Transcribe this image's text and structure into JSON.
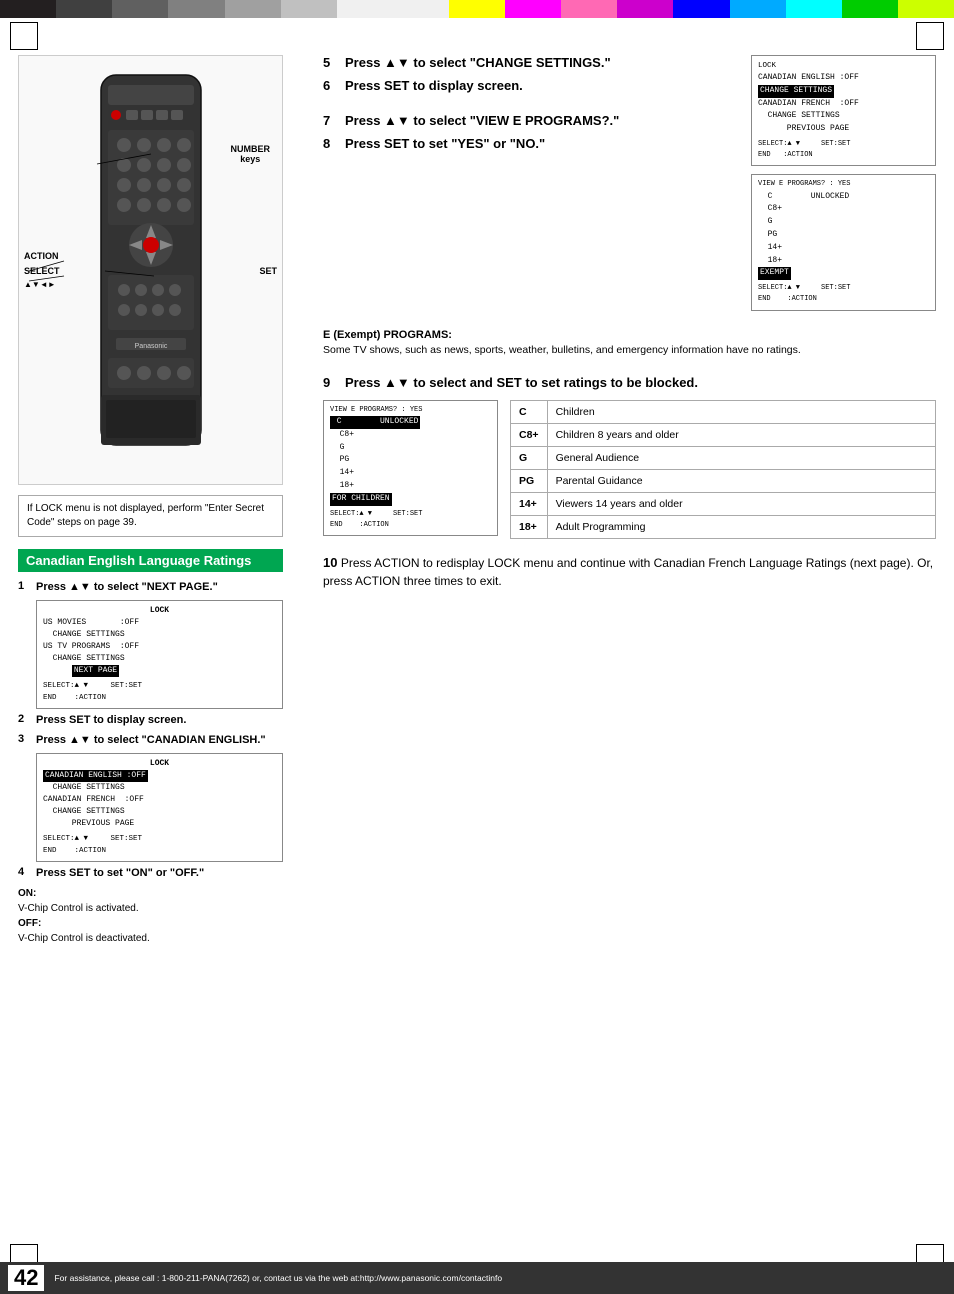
{
  "colors": {
    "topBar": [
      "#231f20",
      "#404040",
      "#606060",
      "#808080",
      "#a0a0a0",
      "#c0c0c0",
      "#ffffff",
      "#ffff00",
      "#ff0000",
      "#ff69b4",
      "#cc00cc",
      "#0000ff",
      "#00aaff",
      "#00ffff",
      "#00cc00",
      "#ccff00"
    ],
    "sectionGreen": "#00a651"
  },
  "page": {
    "number": "42",
    "footer": "For assistance, please call : 1-800-211-PANA(7262) or, contact us via the web at:http://www.panasonic.com/contactinfo"
  },
  "remote": {
    "labels": {
      "number": "NUMBER\nkeys",
      "action": "ACTION",
      "select": "SELECT",
      "arrows": "▲▼◄►",
      "set": "SET"
    }
  },
  "lockNote": {
    "text": "If LOCK menu is not displayed, perform \"Enter Secret Code\" steps on page 39."
  },
  "canadianSection": {
    "header": "Canadian English Language Ratings",
    "steps": [
      {
        "num": "1",
        "bold": "Press ▲▼ to select \"NEXT PAGE.\""
      },
      {
        "num": "2",
        "bold": "Press SET to display screen."
      },
      {
        "num": "3",
        "bold": "Press ▲▼ to select \"CANADIAN ENGLISH.\""
      },
      {
        "num": "4",
        "bold": "Press SET to set \"ON\" or \"OFF.\""
      }
    ],
    "screen1": {
      "title": "LOCK",
      "lines": [
        "US MOVIES       :OFF",
        "  CHANGE SETTINGS",
        "US TV PROGRAMS  :OFF",
        "  CHANGE SETTINGS",
        "  [NEXT PAGE]"
      ],
      "selectLine": "SELECT:▲ ▼      SET:SET",
      "endLine": "END    :ACTION"
    },
    "screen2": {
      "title": "LOCK",
      "lines": [
        "[CANADIAN ENGLISH :OFF]",
        "  CHANGE SETTINGS",
        "CANADIAN FRENCH  :OFF",
        "  CHANGE SETTINGS",
        "       PREVIOUS PAGE"
      ],
      "selectLine": "SELECT:▲ ▼      SET:SET",
      "endLine": "END    :ACTION"
    },
    "onOff": {
      "onTitle": "ON:",
      "onText": "V-Chip Control is activated.",
      "offTitle": "OFF:",
      "offText": "V-Chip Control is deactivated."
    }
  },
  "rightSteps": {
    "step5": {
      "num": "5",
      "bold": "Press ▲▼ to select \"CHANGE SETTINGS.\""
    },
    "step6": {
      "num": "6",
      "bold": "Press SET to display screen."
    },
    "screen5": {
      "title": "LOCK",
      "lines": [
        "CANADIAN ENGLISH :OFF",
        "[CHANGE SETTINGS]",
        "CANADIAN FRENCH  :OFF",
        "  CHANGE SETTINGS",
        "       PREVIOUS PAGE"
      ],
      "selectLine": "SELECT:▲ ▼      SET:SET",
      "endLine": "END   :ACTION"
    },
    "step7": {
      "num": "7",
      "bold": "Press ▲▼ to select \"VIEW E PROGRAMS?.\""
    },
    "step8": {
      "num": "8",
      "bold": "Press SET to set \"YES\" or \"NO.\""
    },
    "screen7": {
      "title": "VIEW E PROGRAMS? : YES",
      "lines": [
        "  C        UNLOCKED",
        "  C8+",
        "  G",
        "  PG",
        "  14+",
        "  18+",
        "[EXEMPT]"
      ],
      "selectLine": "SELECT:▲ ▼      SET:SET",
      "endLine": "END    :ACTION"
    },
    "ePrograms": {
      "title": "E (Exempt) PROGRAMS:",
      "text": "Some TV shows, such as news, sports, weather, bulletins, and emergency information have no ratings."
    }
  },
  "step9": {
    "num": "9",
    "bold": "Press ▲▼ to select and SET to set ratings to be blocked.",
    "screen": {
      "title": "VIEW E PROGRAMS? : YES",
      "lines": [
        "  C        UNLOCKED",
        "  C8+",
        "  G",
        "  PG",
        "  14+",
        "  18+",
        "[FOR CHILDREN]"
      ],
      "selectLine": "SELECT:▲ ▼      SET:SET",
      "endLine": "END    :ACTION"
    }
  },
  "ratingsTable": [
    {
      "code": "C",
      "desc": "Children"
    },
    {
      "code": "C8+",
      "desc": "Children 8 years and older"
    },
    {
      "code": "G",
      "desc": "General Audience"
    },
    {
      "code": "PG",
      "desc": "Parental Guidance"
    },
    {
      "code": "14+",
      "desc": "Viewers 14 years and older"
    },
    {
      "code": "18+",
      "desc": "Adult Programming"
    }
  ],
  "step10": {
    "num": "10",
    "text": "Press ACTION to redisplay LOCK menu and continue with Canadian French Language Ratings (next page). Or, press ACTION three times to exit."
  }
}
